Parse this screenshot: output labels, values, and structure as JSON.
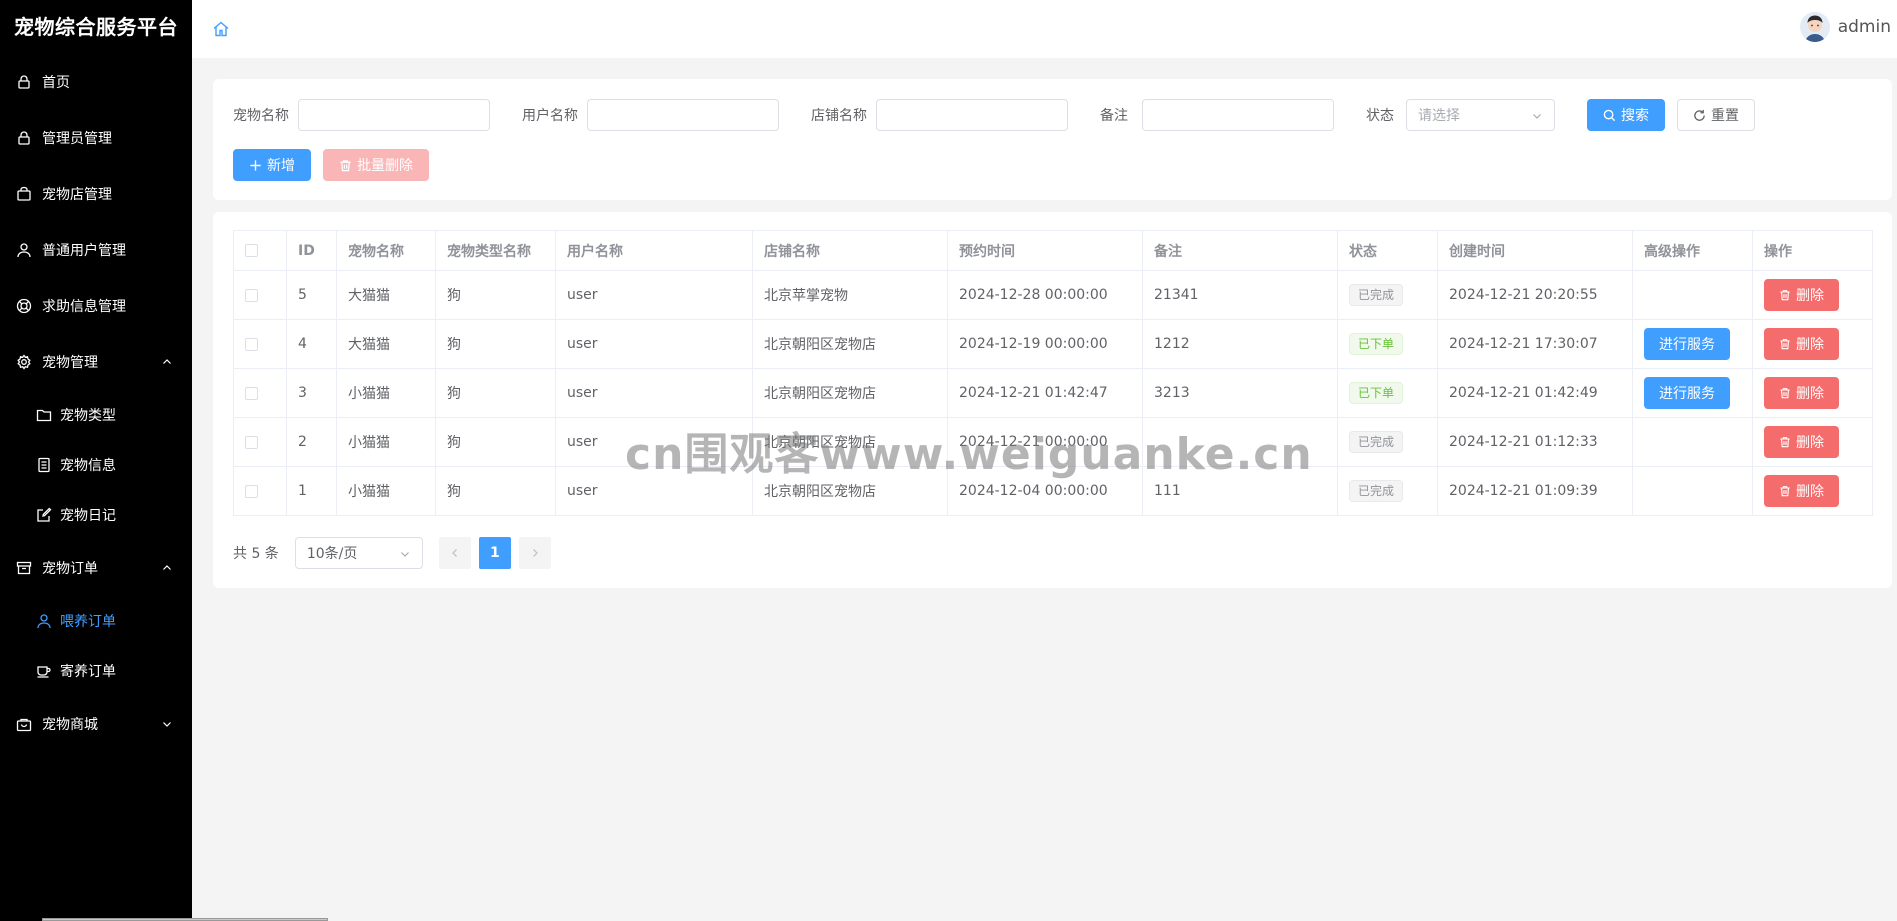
{
  "app": {
    "title": "宠物综合服务平台"
  },
  "sidebar": {
    "items": [
      {
        "label": "首页",
        "icon": "lock-icon"
      },
      {
        "label": "管理员管理",
        "icon": "lock-icon"
      },
      {
        "label": "宠物店管理",
        "icon": "shop-bag-icon"
      },
      {
        "label": "普通用户管理",
        "icon": "user-icon"
      },
      {
        "label": "求助信息管理",
        "icon": "help-icon"
      },
      {
        "label": "宠物管理",
        "icon": "gear-icon",
        "expanded": true,
        "children": [
          {
            "label": "宠物类型",
            "icon": "folder-icon"
          },
          {
            "label": "宠物信息",
            "icon": "document-icon"
          },
          {
            "label": "宠物日记",
            "icon": "edit-icon"
          }
        ]
      },
      {
        "label": "宠物订单",
        "icon": "box-icon",
        "expanded": true,
        "children": [
          {
            "label": "喂养订单",
            "icon": "user-icon",
            "active": true
          },
          {
            "label": "寄养订单",
            "icon": "cup-icon"
          }
        ]
      },
      {
        "label": "宠物商城",
        "icon": "handbag-icon",
        "expanded": false
      }
    ]
  },
  "header": {
    "username": "admin"
  },
  "search": {
    "pet_name_label": "宠物名称",
    "user_name_label": "用户名称",
    "shop_name_label": "店铺名称",
    "remark_label": "备注",
    "status_label": "状态",
    "status_placeholder": "请选择",
    "search_button": "搜索",
    "reset_button": "重置",
    "add_button": "新增",
    "batch_delete_button": "批量删除"
  },
  "table": {
    "columns": [
      "ID",
      "宠物名称",
      "宠物类型名称",
      "用户名称",
      "店铺名称",
      "预约时间",
      "备注",
      "状态",
      "创建时间",
      "高级操作",
      "操作"
    ],
    "service_button": "进行服务",
    "delete_button": "删除",
    "rows": [
      {
        "id": "5",
        "pet": "大猫猫",
        "type": "狗",
        "user": "user",
        "shop": "北京苹掌宠物",
        "appt": "2024-12-28 00:00:00",
        "remark": "21341",
        "status": "已完成",
        "status_kind": "info",
        "created": "2024-12-21 20:20:55",
        "service": false
      },
      {
        "id": "4",
        "pet": "大猫猫",
        "type": "狗",
        "user": "user",
        "shop": "北京朝阳区宠物店",
        "appt": "2024-12-19 00:00:00",
        "remark": "1212",
        "status": "已下单",
        "status_kind": "success",
        "created": "2024-12-21 17:30:07",
        "service": true
      },
      {
        "id": "3",
        "pet": "小猫猫",
        "type": "狗",
        "user": "user",
        "shop": "北京朝阳区宠物店",
        "appt": "2024-12-21 01:42:47",
        "remark": "3213",
        "status": "已下单",
        "status_kind": "success",
        "created": "2024-12-21 01:42:49",
        "service": true
      },
      {
        "id": "2",
        "pet": "小猫猫",
        "type": "狗",
        "user": "user",
        "shop": "北京朝阳区宠物店",
        "appt": "2024-12-21 00:00:00",
        "remark": "",
        "status": "已完成",
        "status_kind": "info",
        "created": "2024-12-21 01:12:33",
        "service": false
      },
      {
        "id": "1",
        "pet": "小猫猫",
        "type": "狗",
        "user": "user",
        "shop": "北京朝阳区宠物店",
        "appt": "2024-12-04 00:00:00",
        "remark": "111",
        "status": "已完成",
        "status_kind": "info",
        "created": "2024-12-21 01:09:39",
        "service": false
      }
    ]
  },
  "pagination": {
    "total_text": "共 5 条",
    "page_size": "10条/页",
    "current_page": "1"
  },
  "watermark": "cn围观客www.weiguanke.cn",
  "colors": {
    "primary": "#409eff",
    "danger": "#f56c6c",
    "sidebar_bg": "#000000",
    "success": "#67c23a"
  }
}
